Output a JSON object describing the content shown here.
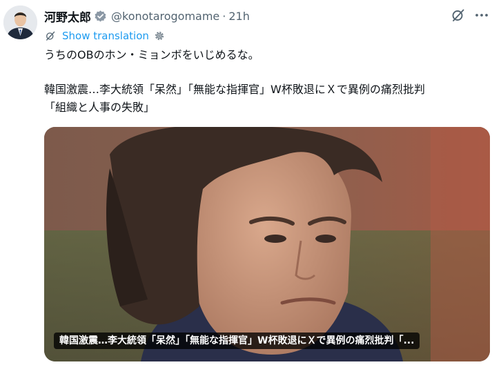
{
  "tweet": {
    "display_name": "河野太郎",
    "handle": "@konotarogomame",
    "separator": "·",
    "time": "21h",
    "translate_label": "Show translation",
    "text_line_1": "うちのOBのホン・ミョンボをいじめるな。",
    "text_line_2": "韓国激震…李大統領「呆然」「無能な指揮官」W杯敗退にＸで異例の痛烈批判",
    "text_line_3": "「組織と人事の失敗」"
  },
  "card": {
    "caption": "韓国激震…李大統領「呆然」「無能な指揮官」W杯敗退にＸで異例の痛烈批判「..."
  },
  "icons": {
    "verified": "verified-badge-icon",
    "grok": "grok-icon",
    "more": "more-icon",
    "translate": "translate-icon",
    "settings": "gear-icon"
  },
  "colors": {
    "text": "#0f1419",
    "secondary": "#536471",
    "link": "#1d9bf0"
  }
}
